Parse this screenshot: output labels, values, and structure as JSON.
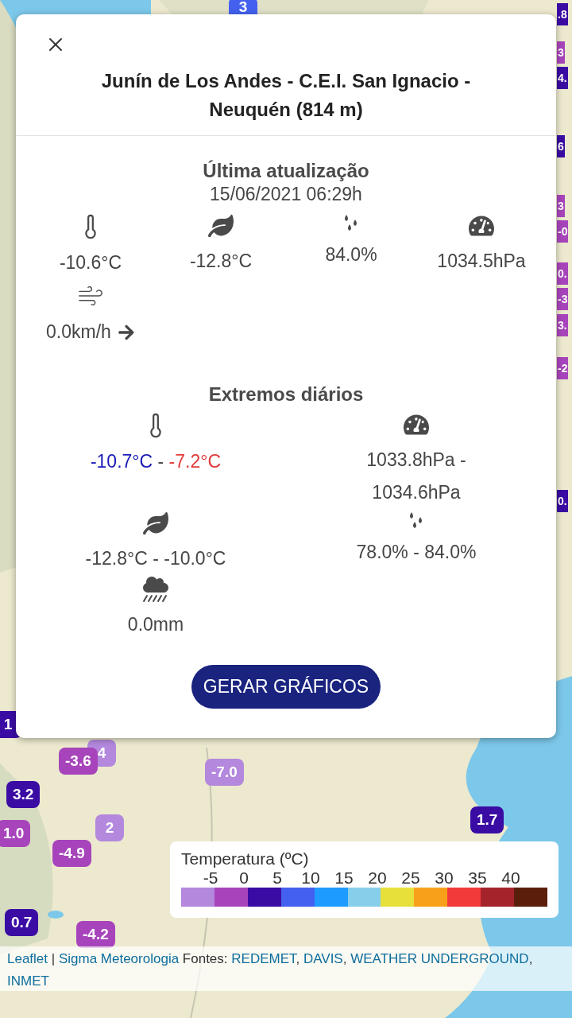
{
  "modal": {
    "title": "Junín de Los Andes - C.E.I. San Ignacio - Neuquén (814 m)",
    "update_heading": "Última atualização",
    "update_time": "15/06/2021 06:29h",
    "current": [
      {
        "kind": "temperature",
        "value": "-10.6°C"
      },
      {
        "kind": "dew_point",
        "value": "-12.8°C"
      },
      {
        "kind": "humidity",
        "value": "84.0%"
      },
      {
        "kind": "pressure",
        "value": "1034.5hPa"
      },
      {
        "kind": "wind",
        "value": "0.0km/h"
      }
    ],
    "extremes_heading": "Extremos diários",
    "extremes": [
      {
        "kind": "temperature",
        "min": "-10.7°C",
        "separator": " - ",
        "max": "-7.2°C",
        "colored": true
      },
      {
        "kind": "pressure",
        "min": "1033.8hPa -",
        "max": "1034.6hPa",
        "colored": false
      },
      {
        "kind": "dew_point",
        "min": "-12.8°C",
        "separator": " - ",
        "max": "-10.0°C",
        "colored": false
      },
      {
        "kind": "humidity",
        "min": "78.0%",
        "separator": " - ",
        "max": "84.0%",
        "colored": false
      },
      {
        "kind": "rain",
        "min": "0.0mm",
        "colored": false
      }
    ],
    "button": "GERAR GRÁFICOS"
  },
  "markers": [
    {
      "text": "3",
      "color": "#4361ee"
    },
    {
      "text": ".8",
      "color": "#3a0ca3"
    },
    {
      "text": "3",
      "color": "#a744bb"
    },
    {
      "text": "4.",
      "color": "#3a0ca3"
    },
    {
      "text": "6",
      "color": "#3a0ca3"
    },
    {
      "text": "3",
      "color": "#a744bb"
    },
    {
      "text": "-0",
      "color": "#a744bb"
    },
    {
      "text": "0.",
      "color": "#a744bb"
    },
    {
      "text": "-3",
      "color": "#a744bb"
    },
    {
      "text": "3.",
      "color": "#a744bb"
    },
    {
      "text": "-2",
      "color": "#a744bb"
    },
    {
      "text": "0.",
      "color": "#3a0ca3"
    },
    {
      "text": "1",
      "color": "#3a0ca3"
    },
    {
      "text": "4",
      "color": "#b388dd"
    },
    {
      "text": "-3.6",
      "color": "#a744bb"
    },
    {
      "text": "-7.0",
      "color": "#b388dd"
    },
    {
      "text": "3.2",
      "color": "#3a0ca3"
    },
    {
      "text": "2",
      "color": "#b388dd"
    },
    {
      "text": "1.0",
      "color": "#a744bb"
    },
    {
      "text": "-4.9",
      "color": "#a744bb"
    },
    {
      "text": "1.7",
      "color": "#3a0ca3"
    },
    {
      "text": "0.7",
      "color": "#3a0ca3"
    },
    {
      "text": "-4.2",
      "color": "#a744bb"
    }
  ],
  "legend": {
    "title": "Temperatura (ºC)",
    "ticks": [
      "-5",
      "0",
      "5",
      "10",
      "15",
      "20",
      "25",
      "30",
      "35",
      "40"
    ],
    "colors": [
      {
        "color": "#b388dd"
      },
      {
        "color": "#a744bb"
      },
      {
        "color": "#3a0ca3"
      },
      {
        "color": "#4361ee"
      },
      {
        "color": "#1e9bff"
      },
      {
        "color": "#87ceeb"
      },
      {
        "color": "#e8e03a"
      },
      {
        "color": "#f9a01b"
      },
      {
        "color": "#f23a3a"
      },
      {
        "color": "#a5242c"
      },
      {
        "color": "#5a1f0a"
      }
    ]
  },
  "attribution": [
    {
      "text": "Leaflet",
      "link": true
    },
    {
      "text": " | ",
      "link": false
    },
    {
      "text": "Sigma Meteorologia",
      "link": true
    },
    {
      "text": " Fontes: ",
      "link": false
    },
    {
      "text": "REDEMET",
      "link": true
    },
    {
      "text": ", ",
      "link": false
    },
    {
      "text": "DAVIS",
      "link": true
    },
    {
      "text": ", ",
      "link": false
    },
    {
      "text": "WEATHER UNDERGROUND",
      "link": true
    },
    {
      "text": ", ",
      "link": false
    },
    {
      "text": "INMET",
      "link": true
    }
  ]
}
